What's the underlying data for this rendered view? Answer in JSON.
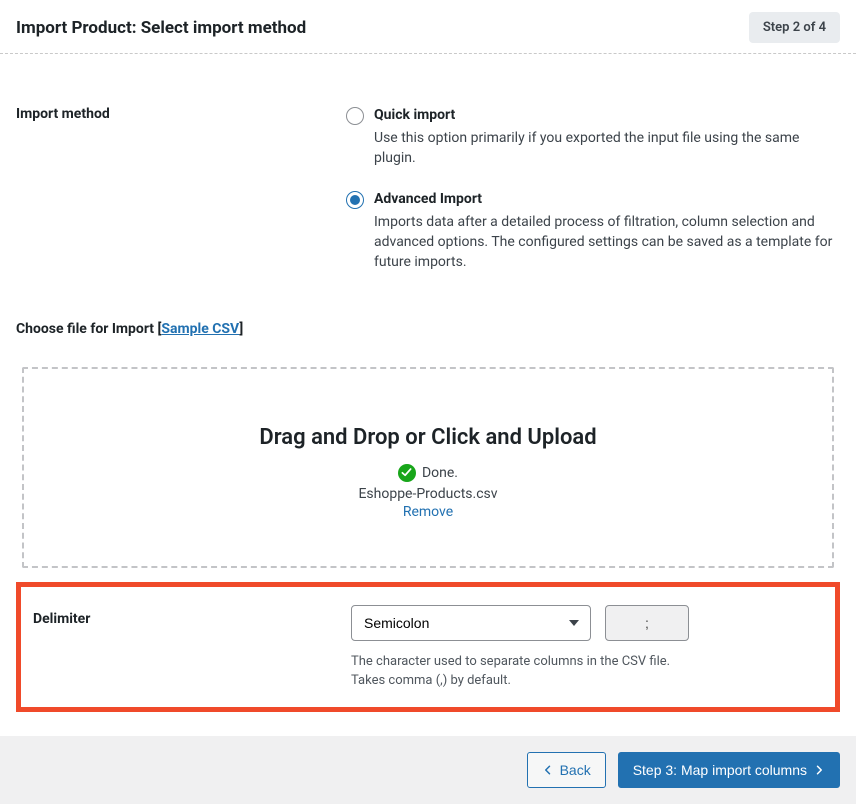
{
  "header": {
    "title": "Import Product: Select import method",
    "step_badge": "Step 2 of 4"
  },
  "import_method": {
    "label": "Import method",
    "options": [
      {
        "title": "Quick import",
        "desc": "Use this option primarily if you exported the input file using the same plugin.",
        "selected": false
      },
      {
        "title": "Advanced Import",
        "desc": "Imports data after a detailed process of filtration, column selection and advanced options. The configured settings can be saved as a template for future imports.",
        "selected": true
      }
    ]
  },
  "file_section": {
    "label_prefix": "Choose file for Import [",
    "sample_link": "Sample CSV",
    "label_suffix": "]"
  },
  "dropzone": {
    "title": "Drag and Drop or Click and Upload",
    "status": "Done.",
    "filename": "Eshoppe-Products.csv",
    "remove": "Remove"
  },
  "delimiter": {
    "label": "Delimiter",
    "selected": "Semicolon",
    "value": ";",
    "help_line1": "The character used to separate columns in the CSV file.",
    "help_line2": "Takes comma (,) by default."
  },
  "footer": {
    "back": "Back",
    "next": "Step 3: Map import columns"
  },
  "colors": {
    "accent": "#2271b1",
    "highlight_border": "#f04a2a",
    "success": "#18a61a"
  }
}
